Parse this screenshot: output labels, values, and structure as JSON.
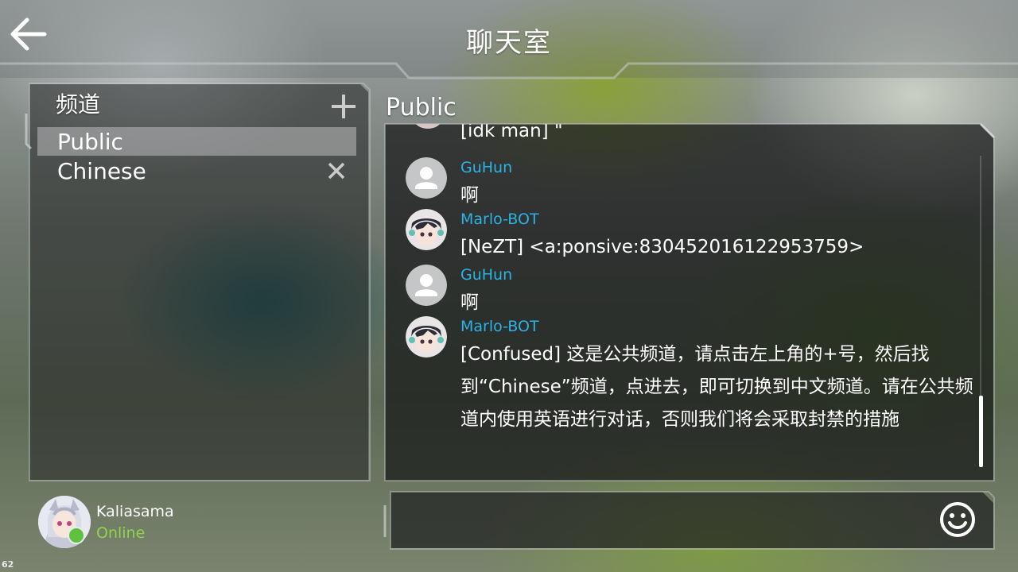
{
  "header": {
    "title": "聊天室"
  },
  "channels": {
    "title": "频道",
    "items": [
      {
        "label": "Public",
        "active": true
      },
      {
        "label": "Chinese",
        "active": false
      }
    ]
  },
  "user": {
    "name": "Kaliasama",
    "status": "Online"
  },
  "fps": "62",
  "chat": {
    "channel_title": "Public",
    "partial_text": "[idk man] \"",
    "messages": [
      {
        "author": "GuHun",
        "text": "啊",
        "avatar": "default-user-icon"
      },
      {
        "author": "Marlo-BOT",
        "text": "[NeZT] <a:ponsive:830452016122953759>",
        "avatar": "anime-avatar"
      },
      {
        "author": "GuHun",
        "text": "啊",
        "avatar": "default-user-icon"
      },
      {
        "author": "Marlo-BOT",
        "text": "[Confused] 这是公共频道，请点击左上角的+号，然后找到“Chinese”频道，点进去，即可切换到中文频道。请在公共频道内使用英语进行对话，否则我们将会采取封禁的措施",
        "avatar": "anime-avatar"
      }
    ]
  },
  "input": {
    "placeholder": "",
    "value": ""
  },
  "colors": {
    "author": "#2bb3e6",
    "online": "#8fd44a"
  }
}
